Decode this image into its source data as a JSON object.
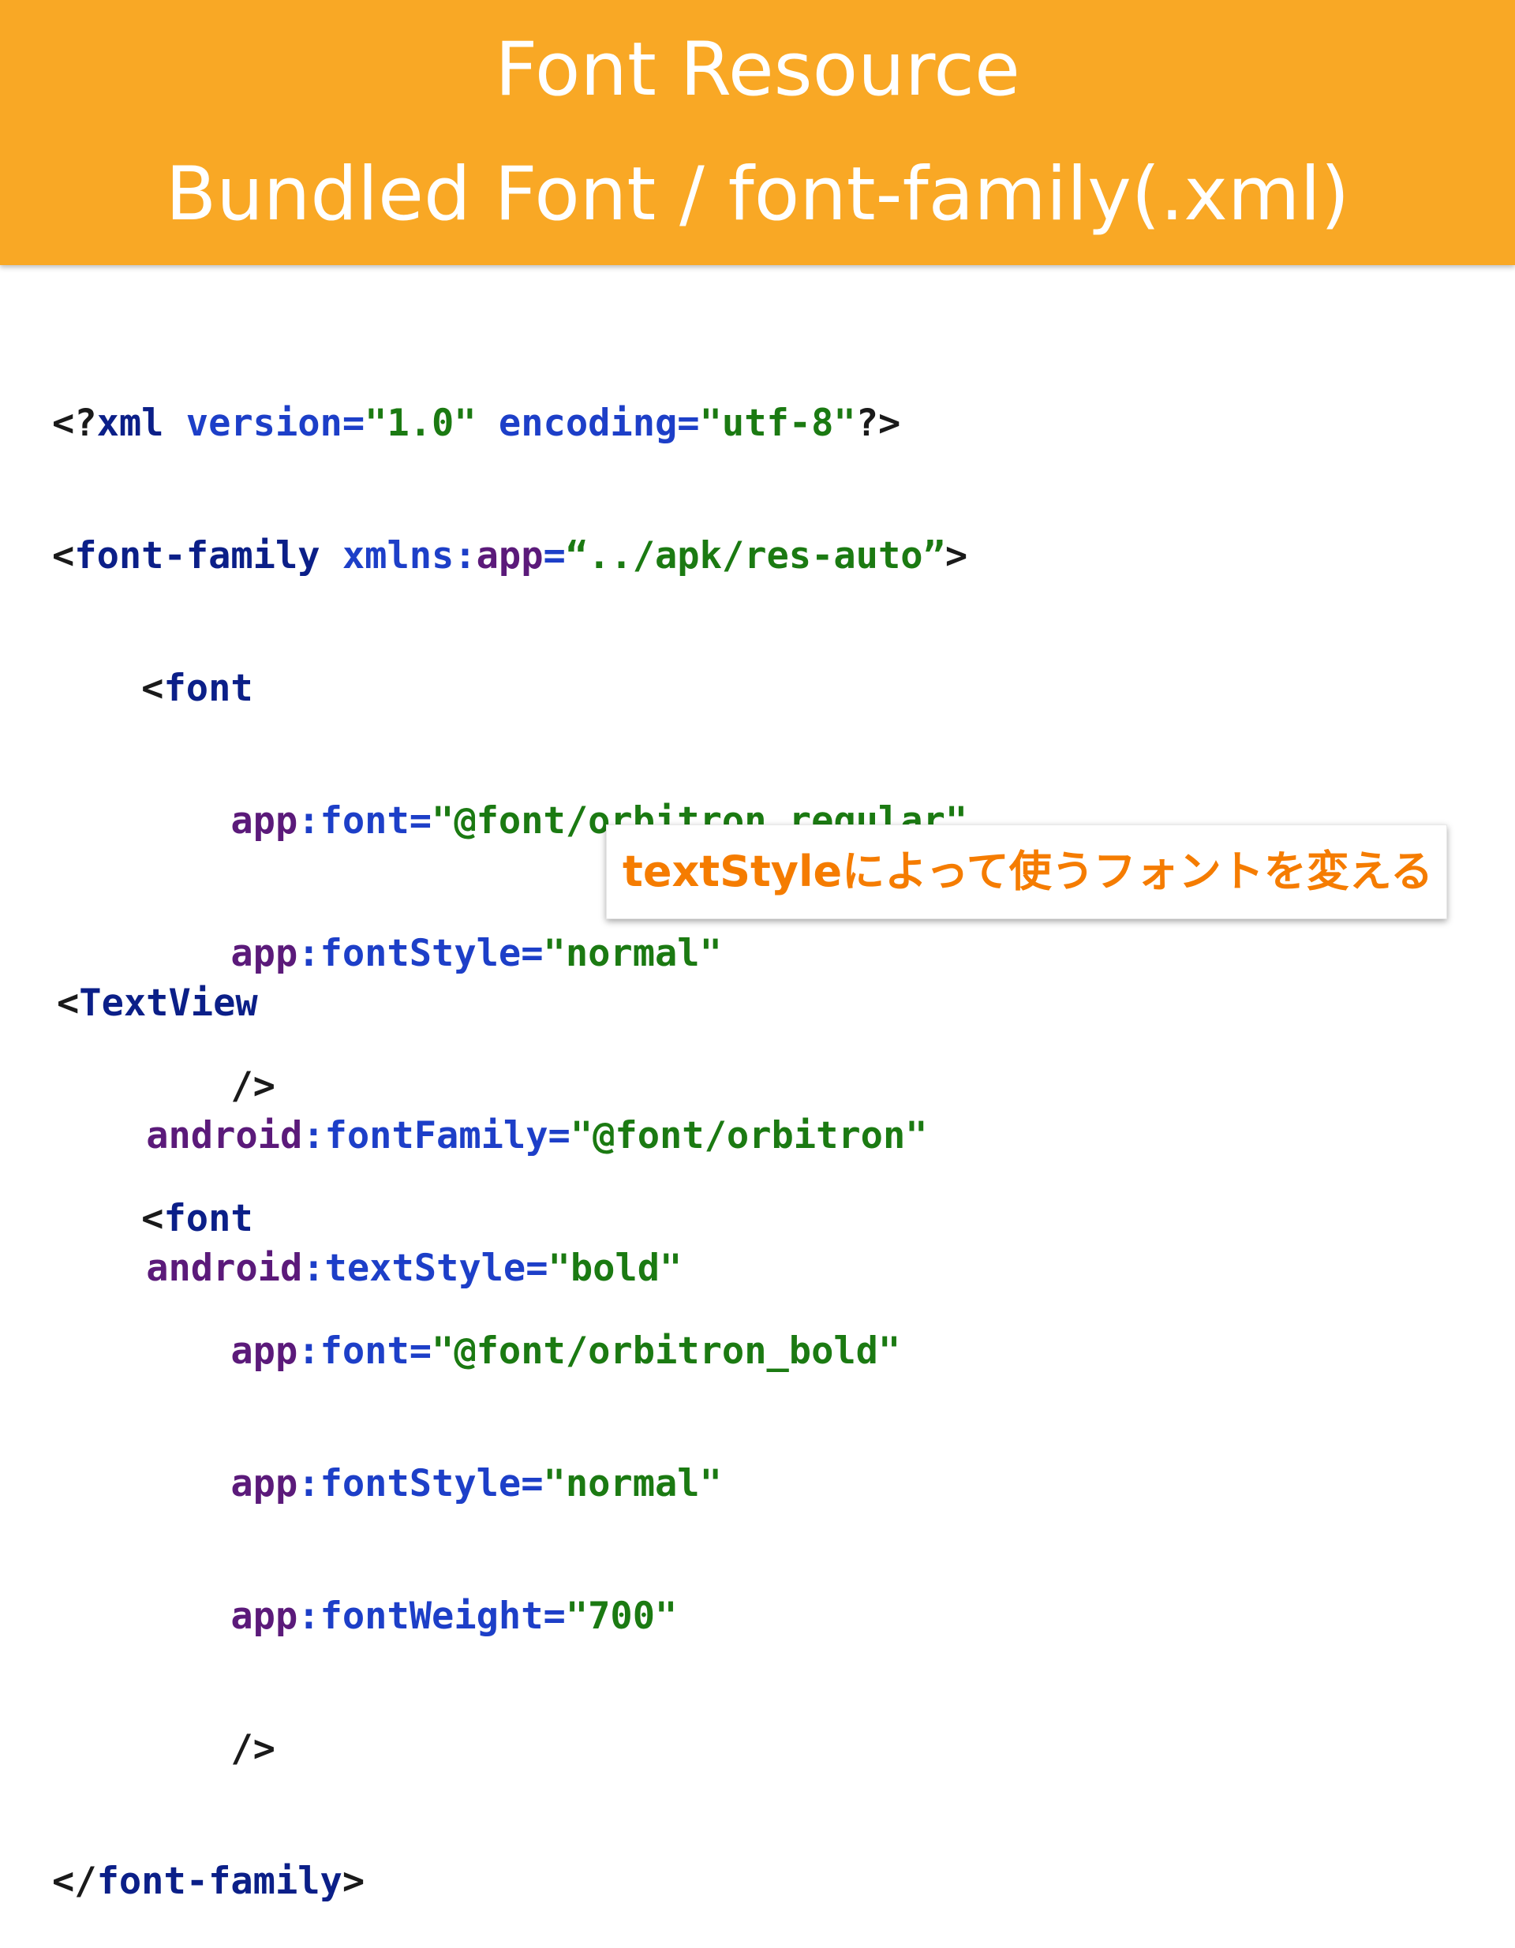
{
  "header": {
    "title": "Font Resource",
    "subtitle": "Bundled Font / font-family(.xml)"
  },
  "code_top": {
    "l1": {
      "t1": "<?",
      "t2": "xml",
      "t3": " version=",
      "t4": "\"1.0\"",
      "t5": " encoding=",
      "t6": "\"utf-8\"",
      "t7": "?>"
    },
    "l2": {
      "t1": "<",
      "t2": "font-family",
      "t3": " xmlns:",
      "t4": "app",
      "t5": "=",
      "t6": "“../apk/res-auto”",
      "t7": ">"
    },
    "l3": {
      "t1": "    <",
      "t2": "font"
    },
    "l4": {
      "t1": "        ",
      "t2": "app",
      "t3": ":font=",
      "t4": "\"@font/orbitron_regular\""
    },
    "l5": {
      "t1": "        ",
      "t2": "app",
      "t3": ":fontStyle=",
      "t4": "\"normal\""
    },
    "l6": {
      "t1": "        />"
    },
    "l7": {
      "t1": "    <",
      "t2": "font"
    },
    "l8": {
      "t1": "        ",
      "t2": "app",
      "t3": ":font=",
      "t4": "\"@font/orbitron_bold\""
    },
    "l9": {
      "t1": "        ",
      "t2": "app",
      "t3": ":fontStyle=",
      "t4": "\"normal\""
    },
    "l10": {
      "t1": "        ",
      "t2": "app",
      "t3": ":fontWeight=",
      "t4": "\"700\""
    },
    "l11": {
      "t1": "        />"
    },
    "l12": {
      "t1": "</",
      "t2": "font-family",
      "t3": ">"
    }
  },
  "code_bottom": {
    "l1": {
      "t1": "<",
      "t2": "TextView"
    },
    "l2": {
      "t1": "    ",
      "t2": "android",
      "t3": ":fontFamily=",
      "t4": "\"@font/orbitron\""
    },
    "l3": {
      "t1": "    ",
      "t2": "android",
      "t3": ":textStyle=",
      "t4": "\"bold\""
    }
  },
  "callout": {
    "text": "textStyleによって使うフォントを変える"
  },
  "colors": {
    "header_bg": "#F9A825",
    "callout_text": "#F57C00",
    "string": "#1b7a12",
    "prefix": "#5b1a7a",
    "element": "#0b1f88",
    "attribute": "#1d3fc8"
  }
}
